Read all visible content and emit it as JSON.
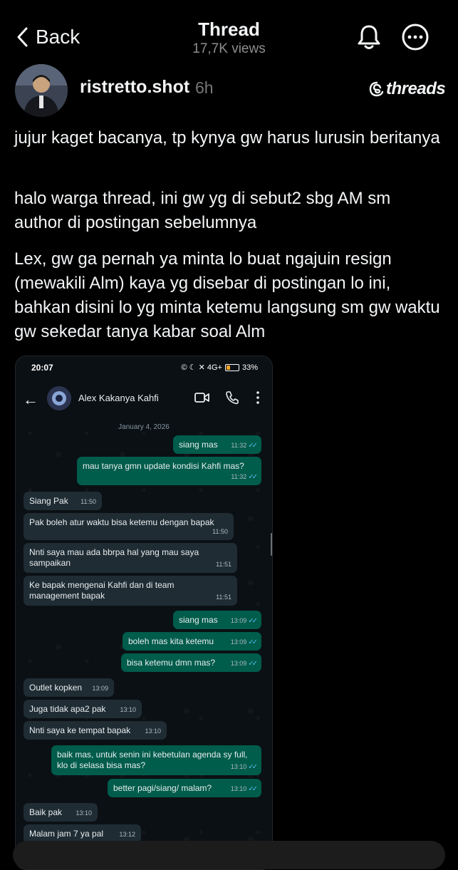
{
  "header": {
    "back_label": "Back",
    "title": "Thread",
    "views": "17,7K views"
  },
  "author": {
    "username": "ristretto.shot",
    "time": "6h",
    "brand": "threads"
  },
  "post": {
    "paragraphs": [
      "jujur kaget bacanya, tp kynya gw harus lurusin beritanya",
      "halo warga thread, ini gw yg di sebut2 sbg AM sm author di postingan sebelumnya",
      "Lex, gw ga pernah ya minta lo buat ngajuin resign (mewakili Alm) kaya yg disebar di postingan lo ini, bahkan disini lo yg minta ketemu langsung sm gw waktu gw sekedar tanya kabar soal Alm"
    ]
  },
  "screenshot": {
    "status_time": "20:07",
    "status_icons": "© ☾ ✕ 4G+",
    "battery": "33%",
    "contact": "Alex Kakanya Kahfi",
    "date": "January 4, 2026",
    "messages": [
      {
        "dir": "out",
        "text": "siang mas",
        "time": "11:32"
      },
      {
        "dir": "out",
        "text": "mau tanya gmn update kondisi Kahfi mas?",
        "time": "11:32"
      },
      {
        "dir": "in",
        "text": "Siang Pak",
        "time": "11:50"
      },
      {
        "dir": "in",
        "text": "Pak boleh atur waktu bisa ketemu dengan bapak",
        "time": "11:50"
      },
      {
        "dir": "in",
        "text": "Nnti saya mau ada bbrpa hal yang mau saya sampaikan",
        "time": "11:51"
      },
      {
        "dir": "in",
        "text": "Ke bapak mengenai Kahfi dan di team management bapak",
        "time": "11:51"
      },
      {
        "dir": "out",
        "text": "siang mas",
        "time": "13:09"
      },
      {
        "dir": "out",
        "text": "boleh mas kita ketemu",
        "time": "13:09"
      },
      {
        "dir": "out",
        "text": "bisa ketemu dmn mas?",
        "time": "13:09"
      },
      {
        "dir": "in",
        "text": "Outlet kopken",
        "time": "13:09"
      },
      {
        "dir": "in",
        "text": "Juga tidak apa2 pak",
        "time": "13:10"
      },
      {
        "dir": "in",
        "text": "Nnti saya ke tempat bapak",
        "time": "13:10"
      },
      {
        "dir": "out",
        "text": "baik mas, untuk senin ini kebetulan agenda sy full, klo di selasa bisa mas?",
        "time": "13:10"
      },
      {
        "dir": "out",
        "text": "better pagi/siang/ malam?",
        "time": "13:10"
      },
      {
        "dir": "in",
        "text": "Baik pak",
        "time": "13:10"
      },
      {
        "dir": "in",
        "text": "Malam jam 7 ya pal",
        "time": "13:12"
      }
    ]
  },
  "colors": {
    "background": "#000000",
    "muted": "#8e8e8e",
    "wa_out": "#005c4b",
    "wa_in": "#1f2c34",
    "tick": "#53bdeb"
  }
}
